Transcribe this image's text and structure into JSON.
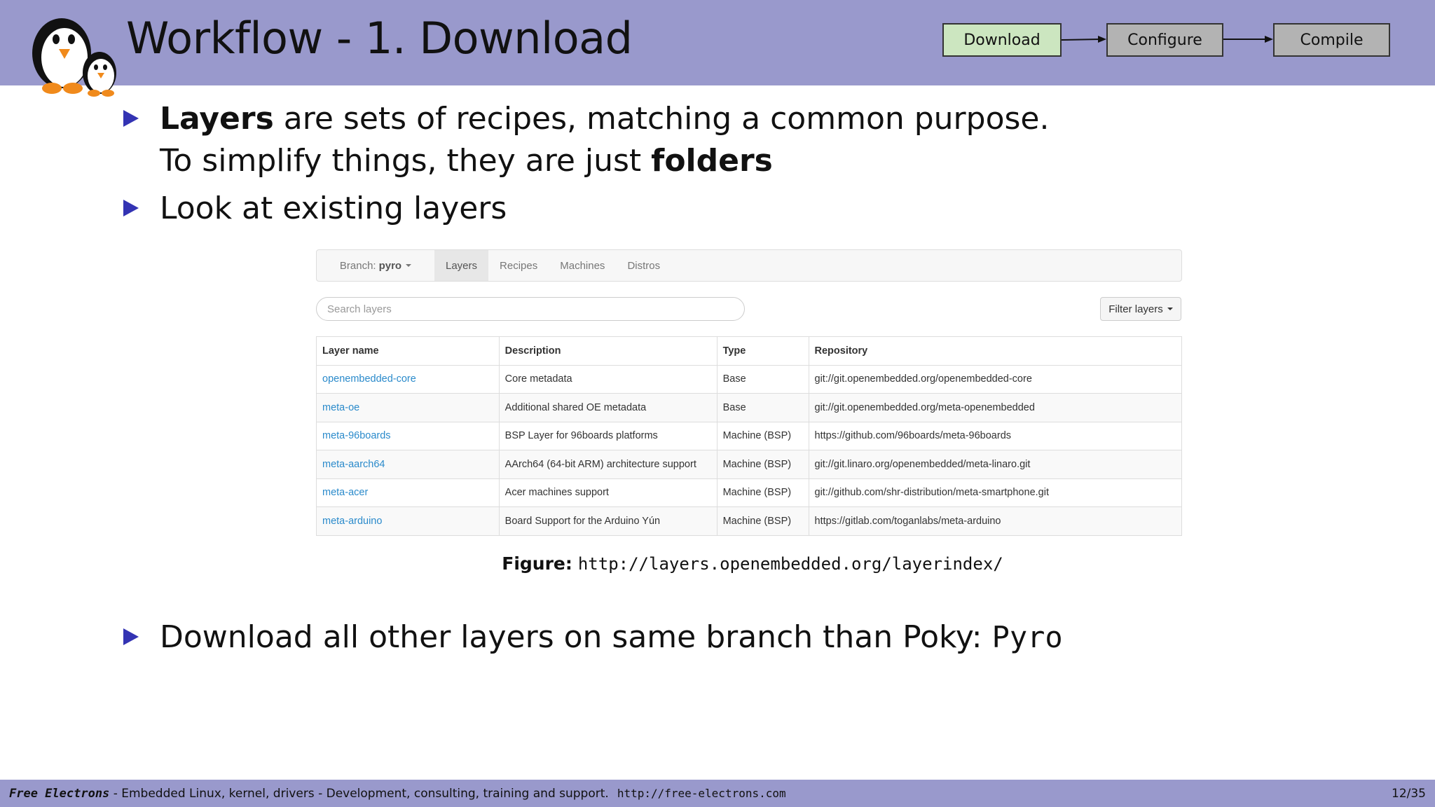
{
  "slide": {
    "title": "Workflow - 1. Download",
    "workflow": [
      "Download",
      "Configure",
      "Compile"
    ]
  },
  "bullets": {
    "b1_bold": "Layers",
    "b1_rest": " are sets of recipes, matching a common purpose.",
    "b1_cont_plain": "To simplify things, they are just ",
    "b1_cont_bold": "folders",
    "b2": "Look at existing layers",
    "b3_plain": "Download all other layers on same branch than Poky: ",
    "b3_mono": "Pyro"
  },
  "layerindex": {
    "branch_label": "Branch:",
    "branch_value": "pyro",
    "tabs": [
      "Layers",
      "Recipes",
      "Machines",
      "Distros"
    ],
    "active_tab": "Layers",
    "search_placeholder": "Search layers",
    "filter_label": "Filter layers",
    "columns": [
      "Layer name",
      "Description",
      "Type",
      "Repository"
    ],
    "rows": [
      [
        "openembedded-core",
        "Core metadata",
        "Base",
        "git://git.openembedded.org/openembedded-core"
      ],
      [
        "meta-oe",
        "Additional shared OE metadata",
        "Base",
        "git://git.openembedded.org/meta-openembedded"
      ],
      [
        "meta-96boards",
        "BSP Layer for 96boards platforms",
        "Machine (BSP)",
        "https://github.com/96boards/meta-96boards"
      ],
      [
        "meta-aarch64",
        "AArch64 (64-bit ARM) architecture support",
        "Machine (BSP)",
        "git://git.linaro.org/openembedded/meta-linaro.git"
      ],
      [
        "meta-acer",
        "Acer machines support",
        "Machine (BSP)",
        "git://github.com/shr-distribution/meta-smartphone.git"
      ],
      [
        "meta-arduino",
        "Board Support for the Arduino Yún",
        "Machine (BSP)",
        "https://gitlab.com/toganlabs/meta-arduino"
      ]
    ]
  },
  "figure": {
    "label": "Figure:",
    "url": "http://layers.openembedded.org/layerindex/"
  },
  "footer": {
    "brand": "Free Electrons",
    "text": " - Embedded Linux, kernel, drivers - Development, consulting, training and support.",
    "url": "http://free-electrons.com",
    "page": "12/35"
  },
  "colors": {
    "band": "#9999cc",
    "bullet": "#3333b3",
    "download_box": "#cce6c0",
    "other_box": "#b3b3b3",
    "link": "#2a8acb"
  },
  "icons": [
    "penguins-logo-icon",
    "bullet-triangle-icon",
    "caret-down-icon"
  ]
}
